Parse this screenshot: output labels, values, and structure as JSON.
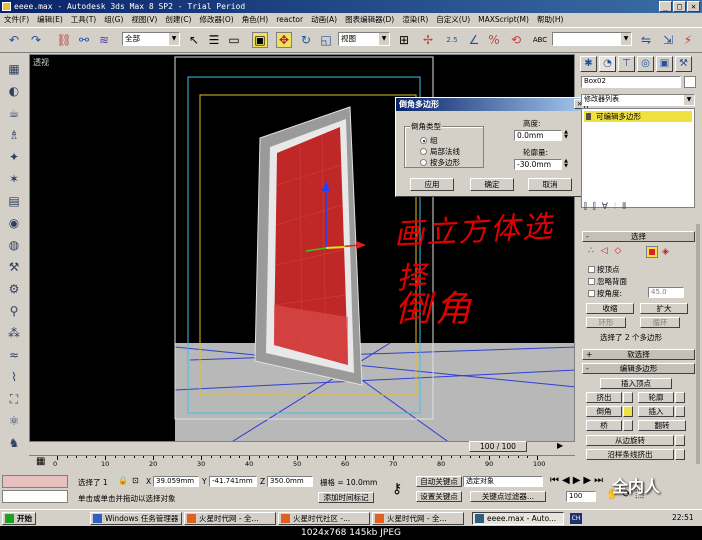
{
  "window": {
    "title": "eeee.max - Autodesk 3ds Max 8 SP2  - Trial Period",
    "min": "_",
    "max": "□",
    "close": "✕"
  },
  "menu": [
    "文件(F)",
    "编辑(E)",
    "工具(T)",
    "组(G)",
    "视图(V)",
    "创建(C)",
    "修改器(O)",
    "角色(H)",
    "reactor",
    "动画(A)",
    "图表编辑器(D)",
    "渲染(R)",
    "自定义(U)",
    "MAXScript(M)",
    "帮助(H)"
  ],
  "toolbar": {
    "selection_filter": "全部",
    "ref_coord": "视图",
    "snap_percent": "2.5",
    "named_sets": ""
  },
  "viewport": {
    "label": "透视",
    "annotation_line1": "画立方体选择",
    "annotation_line2": "倒角",
    "colors": {
      "face": "#c02828",
      "frame": "#9a9a9a",
      "grid": "#3040d0",
      "selection": "#e0c020"
    }
  },
  "dialog": {
    "title": "倒角多边形",
    "close": "×",
    "group_label": "倒角类型",
    "options": [
      {
        "label": "组",
        "selected": true
      },
      {
        "label": "局部法线",
        "selected": false
      },
      {
        "label": "按多边形",
        "selected": false
      }
    ],
    "height_label": "高度:",
    "height_value": "0.0mm",
    "outline_label": "轮廓量:",
    "outline_value": "-30.0mm",
    "apply": "应用",
    "ok": "确定",
    "cancel": "取消"
  },
  "command_panel": {
    "object_name": "Box02",
    "modifier_list": "修改器列表",
    "stack_item": "可编辑多边形",
    "selection_title": "选择",
    "by_vertex": "按顶点",
    "ignore_backfacing": "忽略背面",
    "by_angle": "按角度:",
    "angle_value": "45.0",
    "shrink": "收缩",
    "grow": "扩大",
    "ring": "环形",
    "loop": "循环",
    "selected_info": "选择了 2 个多边形",
    "soft_selection": "软选择",
    "edit_polygons": "编辑多边形",
    "insert_vertex": "插入顶点",
    "buttons": [
      [
        "挤出",
        "轮廓"
      ],
      [
        "倒角",
        "插入"
      ],
      [
        "桥",
        "翻转"
      ]
    ],
    "from_edge": "从边旋转",
    "along_spline": "沿样条线挤出"
  },
  "timeline": {
    "frame": "100 / 100",
    "ticks": [
      "0",
      "10",
      "20",
      "30",
      "40",
      "50",
      "60",
      "70",
      "80",
      "90",
      "100"
    ]
  },
  "status": {
    "selected": "选择了 1",
    "x_label": "X",
    "x": "39.059mm",
    "y_label": "Y",
    "y": "-41.741mm",
    "z_label": "Z",
    "z": "350.0mm",
    "grid": "栅格 = 10.0mm",
    "prompt": "单击或单击并拖动以选择对象",
    "add_time_tag": "添加时间标记",
    "auto_key": "自动关键点",
    "set_key": "设置关键点",
    "selected_objects": "选定对象",
    "key_filters": "关键点过滤器...",
    "frame_field": "100"
  },
  "taskbar": {
    "start": "开始",
    "tasks": [
      "Windows 任务管理器",
      "火星时代网 - 全...",
      "火星时代社区 -...",
      "火星时代网 - 全...",
      "eeee.max - Auto..."
    ],
    "clock": "22:51",
    "ime": "CH"
  },
  "caption": "1024x768  145kb  JPEG",
  "watermark": "全内人"
}
